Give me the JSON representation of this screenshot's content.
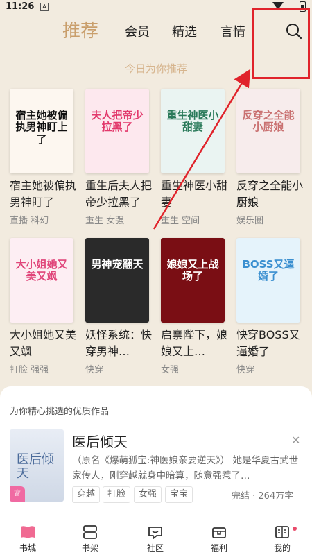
{
  "status": {
    "time": "11:26",
    "sim": "A"
  },
  "tabs": [
    {
      "label": "推荐",
      "active": true
    },
    {
      "label": "会员"
    },
    {
      "label": "精选"
    },
    {
      "label": "言情"
    }
  ],
  "search_icon": "search-icon",
  "section_title": "今日为你推荐",
  "books": [
    {
      "title": "宿主她被偏执男神盯了",
      "tags": "直播 科幻",
      "cover_text": "宿主她被偏执男神盯上了",
      "cover_colors": [
        "#fdf7f0",
        "#111111"
      ]
    },
    {
      "title": "重生后夫人把帝少拉黑了",
      "tags": "重生 女强",
      "cover_text": "夫人把帝少拉黑了",
      "cover_colors": [
        "#fde8ee",
        "#e2386b"
      ]
    },
    {
      "title": "重生神医小甜妻",
      "tags": "重生 空间",
      "cover_text": "重生神医小甜妻",
      "cover_colors": [
        "#eaf4f2",
        "#2a7a5a"
      ]
    },
    {
      "title": "反穿之全能小厨娘",
      "tags": "娱乐圈",
      "cover_text": "反穿之全能小厨娘",
      "cover_colors": [
        "#f7ecec",
        "#c97070"
      ]
    },
    {
      "title": "大小姐她又美又飒",
      "tags": "打脸 强强",
      "cover_text": "大小姐她又美又飒",
      "cover_colors": [
        "#fdeef3",
        "#e0457a"
      ]
    },
    {
      "title": "妖怪系统：快穿男神…",
      "tags": "快穿",
      "cover_text": "男神宠翻天",
      "cover_colors": [
        "#2a2a2a",
        "#ffffff"
      ]
    },
    {
      "title": "启禀陛下，娘娘又上…",
      "tags": "女强",
      "cover_text": "娘娘又上战场了",
      "cover_colors": [
        "#7a0e14",
        "#ffffff"
      ]
    },
    {
      "title": "快穿BOSS又逼婚了",
      "tags": "快穿",
      "cover_text": "BOSS又逼婚了",
      "cover_colors": [
        "#e5f3fb",
        "#3a8fd0"
      ]
    }
  ],
  "featured": {
    "header": "为你精心挑选的优质作品",
    "title": "医后倾天",
    "description": "（原名《爆萌狐宝:神医娘亲要逆天》） 她是华夏古武世家传人，刚穿越就身中暗算，随意强惹了…",
    "tags": [
      "穿越",
      "打脸",
      "女强",
      "宝宝"
    ],
    "meta": "完结 · 264万字",
    "cover_text": "医后倾天",
    "badge": "♕",
    "close": "✕"
  },
  "nav": [
    {
      "label": "书城",
      "icon": "bookstore-icon",
      "active": true
    },
    {
      "label": "书架",
      "icon": "bookshelf-icon"
    },
    {
      "label": "社区",
      "icon": "community-icon"
    },
    {
      "label": "福利",
      "icon": "welfare-icon"
    },
    {
      "label": "我的",
      "icon": "profile-icon"
    }
  ],
  "colors": {
    "accent": "#c99e6b",
    "background": "#f2ebdf",
    "annotation": "#e0232b"
  }
}
